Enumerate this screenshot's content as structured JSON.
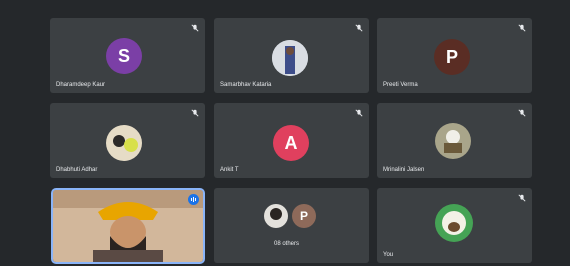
{
  "participants": [
    {
      "name": "Dharamdeep Kaur",
      "initial": "S",
      "avatar_color": "#7b3fa6"
    },
    {
      "name": "Samarbhav Kataria",
      "initial": "",
      "avatar_color": "#c8d0d8"
    },
    {
      "name": "Preeti Verma",
      "initial": "P",
      "avatar_color": "#5a2d24"
    },
    {
      "name": "Dhabhuti Adhar",
      "initial": "",
      "avatar_color": "#d7c7a8"
    },
    {
      "name": "Ankit T",
      "initial": "A",
      "avatar_color": "#e0405e"
    },
    {
      "name": "Mrinalini Jalsen",
      "initial": "",
      "avatar_color": "#8b8a6e"
    },
    {
      "name": "",
      "initial": "",
      "avatar_color": "#000000"
    },
    {
      "name": "08 others",
      "initial": "P",
      "avatar_color": "#8e6a5a"
    },
    {
      "name": "You",
      "initial": "",
      "avatar_color": "#b9d7b0"
    }
  ],
  "colors": {
    "tile": "#3c4043",
    "selected_border": "#8ab4f8",
    "badge": "#1a73e8"
  }
}
